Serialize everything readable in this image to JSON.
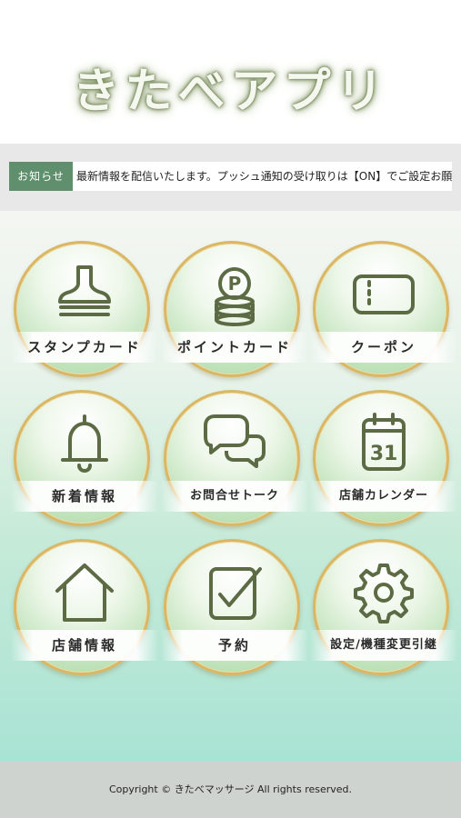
{
  "header": {
    "app_title": "きたべアプリ"
  },
  "news": {
    "badge": "お知らせ",
    "ticker": "最新情報を配信いたします。プッシュ通知の受け取りは【ON】でご設定お願いします。"
  },
  "menu": {
    "items": [
      {
        "label": "スタンプカード",
        "icon": "stamp-icon"
      },
      {
        "label": "ポイントカード",
        "icon": "point-coins-icon"
      },
      {
        "label": "クーポン",
        "icon": "coupon-ticket-icon"
      },
      {
        "label": "新着情報",
        "icon": "bell-icon"
      },
      {
        "label": "お問合せトーク",
        "icon": "chat-bubbles-icon"
      },
      {
        "label": "店舗カレンダー",
        "icon": "calendar-icon"
      },
      {
        "label": "店舗情報",
        "icon": "home-icon"
      },
      {
        "label": "予約",
        "icon": "checkbox-icon"
      },
      {
        "label": "設定/機種変更引継",
        "icon": "gear-icon"
      }
    ]
  },
  "calendar_icon_day": "31",
  "point_icon_letter": "P",
  "footer": {
    "copyright": "Copyright © きたべマッサージ All rights reserved."
  },
  "colors": {
    "accent_green": "#5f8f6c",
    "gold_border": "#d9b765",
    "icon_stroke": "#5d6b45"
  }
}
